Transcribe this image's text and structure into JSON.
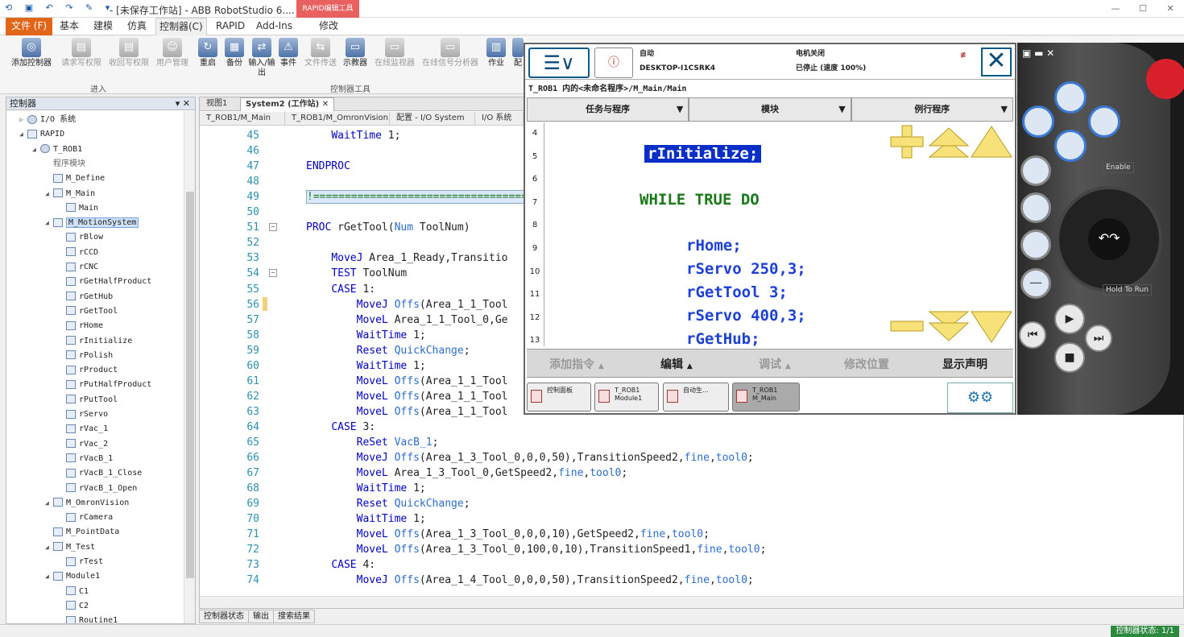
{
  "window": {
    "title": "- [未保存工作站] - ABB RobotStudio 6....",
    "context_tab": "RAPID编辑工具"
  },
  "menu": {
    "tabs": [
      "文件 (F)",
      "基本",
      "建模",
      "仿真",
      "控制器(C)",
      "RAPID",
      "Add-Ins",
      "修改"
    ]
  },
  "ribbon": {
    "buttons": [
      "添加控制器",
      "请求写权限",
      "收回写权限",
      "用户管理",
      "重启",
      "备份",
      "输入/输出",
      "事件",
      "文件传送",
      "示教器",
      "在线监视器",
      "在线信号分析器",
      "作业",
      "配"
    ],
    "groups": [
      "进入",
      "控制器工具"
    ]
  },
  "left_panel": {
    "title": "控制器",
    "tree": [
      {
        "label": "I/O 系统",
        "indent": 1,
        "exp": "▷",
        "icon": "gear"
      },
      {
        "label": "RAPID",
        "indent": 1,
        "exp": "◢",
        "icon": "box"
      },
      {
        "label": "T_ROB1",
        "indent": 2,
        "exp": "◢",
        "icon": "gear"
      },
      {
        "label": "程序模块",
        "indent": 3,
        "exp": "",
        "icon": "none",
        "grey": true
      },
      {
        "label": "M_Define",
        "indent": 3,
        "exp": "",
        "icon": "box"
      },
      {
        "label": "M_Main",
        "indent": 3,
        "exp": "◢",
        "icon": "box"
      },
      {
        "label": "Main",
        "indent": 4,
        "exp": "",
        "icon": "box"
      },
      {
        "label": "M_MotionSystem",
        "indent": 3,
        "exp": "◢",
        "icon": "box",
        "sel": true
      },
      {
        "label": "rBlow",
        "indent": 4,
        "exp": "",
        "icon": "box"
      },
      {
        "label": "rCCD",
        "indent": 4,
        "exp": "",
        "icon": "box"
      },
      {
        "label": "rCNC",
        "indent": 4,
        "exp": "",
        "icon": "box"
      },
      {
        "label": "rGetHalfProduct",
        "indent": 4,
        "exp": "",
        "icon": "box"
      },
      {
        "label": "rGetHub",
        "indent": 4,
        "exp": "",
        "icon": "box"
      },
      {
        "label": "rGetTool",
        "indent": 4,
        "exp": "",
        "icon": "box"
      },
      {
        "label": "rHome",
        "indent": 4,
        "exp": "",
        "icon": "box"
      },
      {
        "label": "rInitialize",
        "indent": 4,
        "exp": "",
        "icon": "box"
      },
      {
        "label": "rPolish",
        "indent": 4,
        "exp": "",
        "icon": "box"
      },
      {
        "label": "rProduct",
        "indent": 4,
        "exp": "",
        "icon": "box"
      },
      {
        "label": "rPutHalfProduct",
        "indent": 4,
        "exp": "",
        "icon": "box"
      },
      {
        "label": "rPutTool",
        "indent": 4,
        "exp": "",
        "icon": "box"
      },
      {
        "label": "rServo",
        "indent": 4,
        "exp": "",
        "icon": "box"
      },
      {
        "label": "rVac_1",
        "indent": 4,
        "exp": "",
        "icon": "box"
      },
      {
        "label": "rVac_2",
        "indent": 4,
        "exp": "",
        "icon": "box"
      },
      {
        "label": "rVacB_1",
        "indent": 4,
        "exp": "",
        "icon": "box"
      },
      {
        "label": "rVacB_1_Close",
        "indent": 4,
        "exp": "",
        "icon": "box"
      },
      {
        "label": "rVacB_1_Open",
        "indent": 4,
        "exp": "",
        "icon": "box"
      },
      {
        "label": "M_OmronVision",
        "indent": 3,
        "exp": "◢",
        "icon": "box"
      },
      {
        "label": "rCamera",
        "indent": 4,
        "exp": "",
        "icon": "box"
      },
      {
        "label": "M_PointData",
        "indent": 3,
        "exp": "",
        "icon": "box"
      },
      {
        "label": "M_Test",
        "indent": 3,
        "exp": "◢",
        "icon": "box"
      },
      {
        "label": "rTest",
        "indent": 4,
        "exp": "",
        "icon": "box"
      },
      {
        "label": "Module1",
        "indent": 3,
        "exp": "◢",
        "icon": "box"
      },
      {
        "label": "C1",
        "indent": 4,
        "exp": "",
        "icon": "box"
      },
      {
        "label": "C2",
        "indent": 4,
        "exp": "",
        "icon": "box"
      },
      {
        "label": "Routine1",
        "indent": 4,
        "exp": "",
        "icon": "box"
      }
    ]
  },
  "editor": {
    "doc_tabs": [
      "视图1",
      "System2 (工作站)"
    ],
    "sub_tabs": [
      "T_ROB1/M_Main",
      "T_ROB1/M_OmronVision",
      "配置 - I/O System",
      "I/O 系统"
    ],
    "lines": [
      {
        "n": "45",
        "t": "    WaitTime 1;"
      },
      {
        "n": "46",
        "t": ""
      },
      {
        "n": "47",
        "t": "ENDPROC",
        "kw": true
      },
      {
        "n": "48",
        "t": ""
      },
      {
        "n": "49",
        "t": "!=================================="
      },
      {
        "n": "50",
        "t": ""
      },
      {
        "n": "51",
        "t": "PROC rGetTool(Num ToolNum)",
        "fold": "−"
      },
      {
        "n": "52",
        "t": ""
      },
      {
        "n": "53",
        "t": "    MoveJ Area_1_Ready,Transitio"
      },
      {
        "n": "54",
        "t": "    TEST ToolNum",
        "fold": "−"
      },
      {
        "n": "55",
        "t": "    CASE 1:"
      },
      {
        "n": "56",
        "t": "        MoveJ Offs(Area_1_1_Tool"
      },
      {
        "n": "57",
        "t": "        MoveL Area_1_1_Tool_0,Ge"
      },
      {
        "n": "58",
        "t": "        WaitTime 1;"
      },
      {
        "n": "59",
        "t": "        Reset QuickChange;"
      },
      {
        "n": "60",
        "t": "        WaitTime 1;"
      },
      {
        "n": "61",
        "t": "        MoveL Offs(Area_1_1_Tool"
      },
      {
        "n": "62",
        "t": "        MoveL Offs(Area_1_1_Tool"
      },
      {
        "n": "63",
        "t": "        MoveL Offs(Area_1_1_Tool"
      },
      {
        "n": "64",
        "t": "    CASE 3:"
      },
      {
        "n": "65",
        "t": "        ReSet VacB_1;"
      },
      {
        "n": "66",
        "t": "        MoveJ Offs(Area_1_3_Tool_0,0,0,50),TransitionSpeed2,fine,tool0;"
      },
      {
        "n": "67",
        "t": "        MoveL Area_1_3_Tool_0,GetSpeed2,fine,tool0;"
      },
      {
        "n": "68",
        "t": "        WaitTime 1;"
      },
      {
        "n": "69",
        "t": "        Reset QuickChange;"
      },
      {
        "n": "70",
        "t": "        WaitTime 1;"
      },
      {
        "n": "71",
        "t": "        MoveL Offs(Area_1_3_Tool_0,0,0,10),GetSpeed2,fine,tool0;"
      },
      {
        "n": "72",
        "t": "        MoveL Offs(Area_1_3_Tool_0,100,0,10),TransitionSpeed1,fine,tool0;"
      },
      {
        "n": "73",
        "t": "    CASE 4:"
      },
      {
        "n": "74",
        "t": "        MoveJ Offs(Area_1_4_Tool_0,0,0,50),TransitionSpeed2,fine,tool0;"
      }
    ]
  },
  "bottom_tabs": [
    "控制器状态",
    "输出",
    "搜索结果"
  ],
  "status": {
    "right": "控制器状态: 1/1"
  },
  "flexpendant": {
    "mode": "自动",
    "host": "DESKTOP-I1CSRK4",
    "motor": "电机关闭",
    "state": "已停止 (速度 100%)",
    "path": "T_ROB1 内的<未命名程序>/M_Main/Main",
    "headers": [
      "任务与程序",
      "模块",
      "例行程序"
    ],
    "line_numbers": [
      "4",
      "5",
      "6",
      "7",
      "8",
      "9",
      "10",
      "11",
      "12",
      "13"
    ],
    "code": [
      {
        "t": "rInitialize;",
        "hl": true
      },
      {
        "t": "WHILE TRUE DO",
        "kw": true
      },
      {
        "t": "rHome;"
      },
      {
        "t": "rServo 250,3;"
      },
      {
        "t": "rGetTool 3;"
      },
      {
        "t": "rServo 400,3;"
      },
      {
        "t": "rGetHub;"
      }
    ],
    "buttons": [
      "添加指令",
      "编辑",
      "调试",
      "修改位置",
      "显示声明"
    ],
    "tasks": [
      {
        "l1": "控制面板",
        "l2": ""
      },
      {
        "l1": "T_ROB1",
        "l2": "Module1"
      },
      {
        "l1": "自动生...",
        "l2": ""
      },
      {
        "l1": "T_ROB1",
        "l2": "M_Main"
      }
    ],
    "enable_label": "Enable",
    "hold_label": "Hold To Run"
  }
}
